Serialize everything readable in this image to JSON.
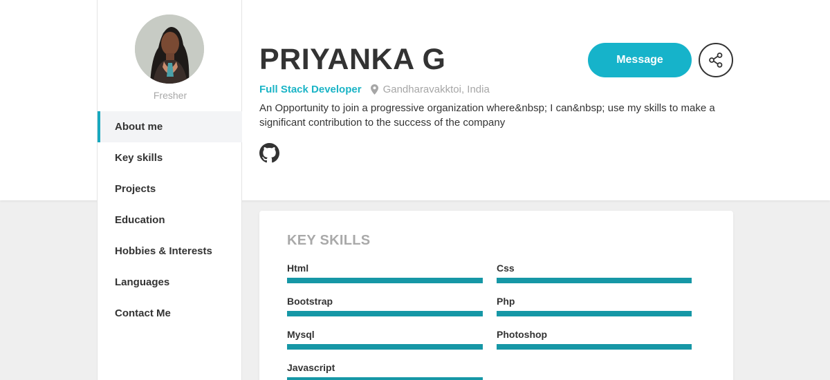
{
  "profile": {
    "name": "PRIYANKA G",
    "role": "Full Stack Developer",
    "location": "Gandharavakktoi, India",
    "status": "Fresher",
    "bio": "An Opportunity to join a progressive organization where&nbsp; I can&nbsp; use my skills to make a significant contribution to the success of the company"
  },
  "actions": {
    "message_label": "Message"
  },
  "sidebar": {
    "items": [
      {
        "label": "About me",
        "active": true
      },
      {
        "label": "Key skills",
        "active": false
      },
      {
        "label": "Projects",
        "active": false
      },
      {
        "label": "Education",
        "active": false
      },
      {
        "label": "Hobbies & Interests",
        "active": false
      },
      {
        "label": "Languages",
        "active": false
      },
      {
        "label": "Contact Me",
        "active": false
      }
    ]
  },
  "skills_section": {
    "title": "KEY SKILLS",
    "skills": [
      {
        "name": "Html",
        "level": 100
      },
      {
        "name": "Css",
        "level": 100
      },
      {
        "name": "Bootstrap",
        "level": 100
      },
      {
        "name": "Php",
        "level": 100
      },
      {
        "name": "Mysql",
        "level": 100
      },
      {
        "name": "Photoshop",
        "level": 100
      },
      {
        "name": "Javascript",
        "level": 100
      }
    ]
  },
  "colors": {
    "accent": "#16b3ca",
    "skill_bar": "#1697a6",
    "active_border": "#17a8be"
  },
  "icons": {
    "location": "map-pin-icon",
    "share": "share-icon",
    "github": "github-icon"
  }
}
